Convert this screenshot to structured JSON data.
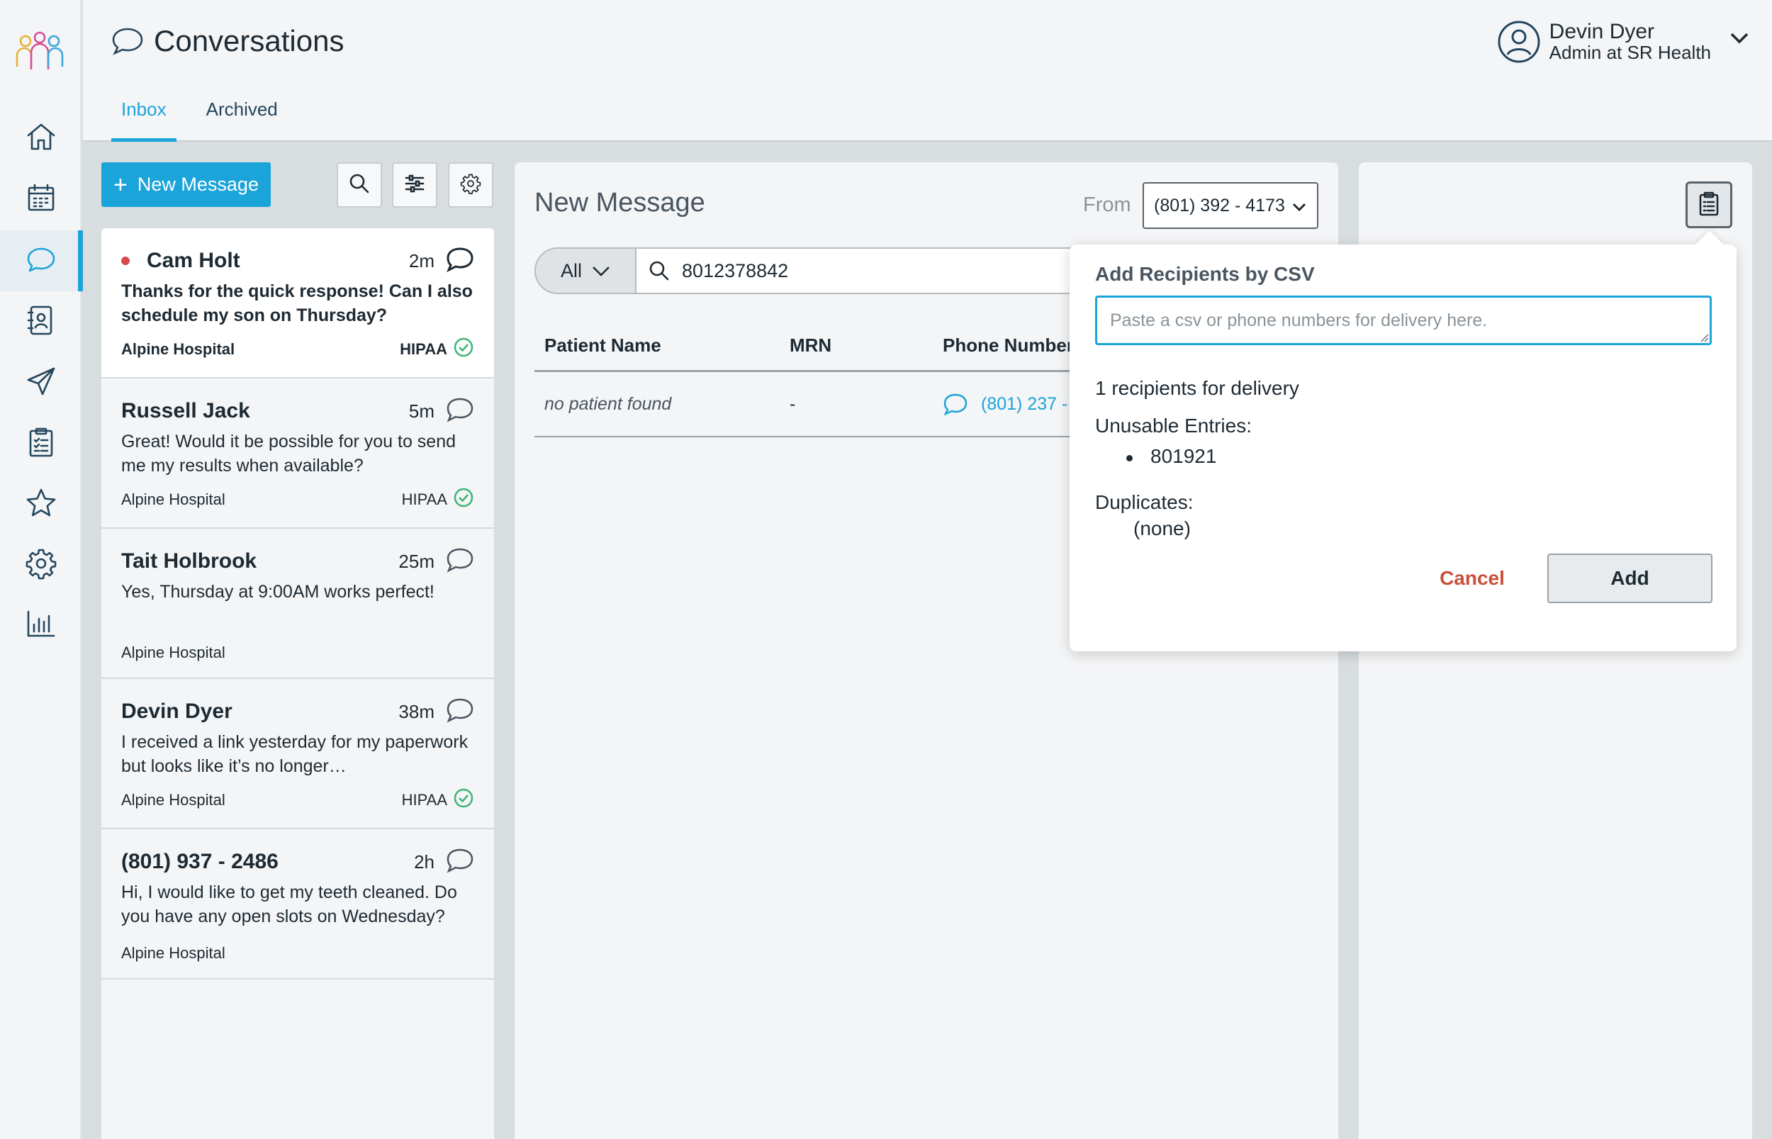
{
  "header": {
    "title": "Conversations",
    "tabs": [
      {
        "label": "Inbox",
        "active": true
      },
      {
        "label": "Archived",
        "active": false
      }
    ]
  },
  "user": {
    "name": "Devin Dyer",
    "role": "Admin at SR Health"
  },
  "nav": {
    "items": [
      {
        "icon": "home-icon"
      },
      {
        "icon": "calendar-icon"
      },
      {
        "icon": "chat-icon",
        "active": true
      },
      {
        "icon": "contacts-icon"
      },
      {
        "icon": "send-icon"
      },
      {
        "icon": "clipboard-icon"
      },
      {
        "icon": "star-icon"
      },
      {
        "icon": "gear-icon"
      },
      {
        "icon": "bar-chart-icon"
      }
    ]
  },
  "toolbar": {
    "new_message_label": "New Message"
  },
  "conversations": [
    {
      "name": "Cam Holt",
      "time": "2m",
      "preview": "Thanks for the quick response! Can I also schedule my son on Thursday?",
      "org": "Alpine Hospital",
      "hipaa": "HIPAA",
      "unread": true
    },
    {
      "name": "Russell Jack",
      "time": "5m",
      "preview": "Great! Would it be possible for you to send me my results when available?",
      "org": "Alpine Hospital",
      "hipaa": "HIPAA",
      "unread": false
    },
    {
      "name": "Tait Holbrook",
      "time": "25m",
      "preview": "Yes, Thursday at 9:00AM works perfect!",
      "org": "Alpine Hospital",
      "hipaa": "",
      "unread": false
    },
    {
      "name": "Devin Dyer",
      "time": "38m",
      "preview": "I received a link yesterday for my paperwork but looks like it’s no longer…",
      "org": "Alpine Hospital",
      "hipaa": "HIPAA",
      "unread": false
    },
    {
      "name": "(801) 937 - 2486",
      "time": "2h",
      "preview": "Hi, I would like to get my teeth cleaned. Do you have any open slots on Wednesday?",
      "org": "Alpine Hospital",
      "hipaa": "",
      "unread": false
    }
  ],
  "compose": {
    "title": "New Message",
    "from_label": "From",
    "from_value": "(801) 392 - 4173",
    "filter_value": "All",
    "search_value": "8012378842",
    "table": {
      "headers": [
        "Patient Name",
        "MRN",
        "Phone Number"
      ],
      "rows": [
        {
          "patient": "no patient found",
          "mrn": "-",
          "phone": "(801) 237 -"
        }
      ]
    }
  },
  "csv_popover": {
    "title": "Add Recipients by CSV",
    "placeholder": "Paste a csv or phone numbers for delivery here.",
    "recipients_text": "1 recipients for delivery",
    "unusable_label": "Unusable Entries:",
    "unusable_entries": [
      "801921"
    ],
    "duplicates_label": "Duplicates:",
    "duplicates_value": "(none)",
    "cancel_label": "Cancel",
    "add_label": "Add"
  },
  "colors": {
    "accent": "#1ba4d9",
    "unread_dot": "#d94b4b",
    "hipaa_check": "#3bb477",
    "cancel": "#c9503a"
  }
}
